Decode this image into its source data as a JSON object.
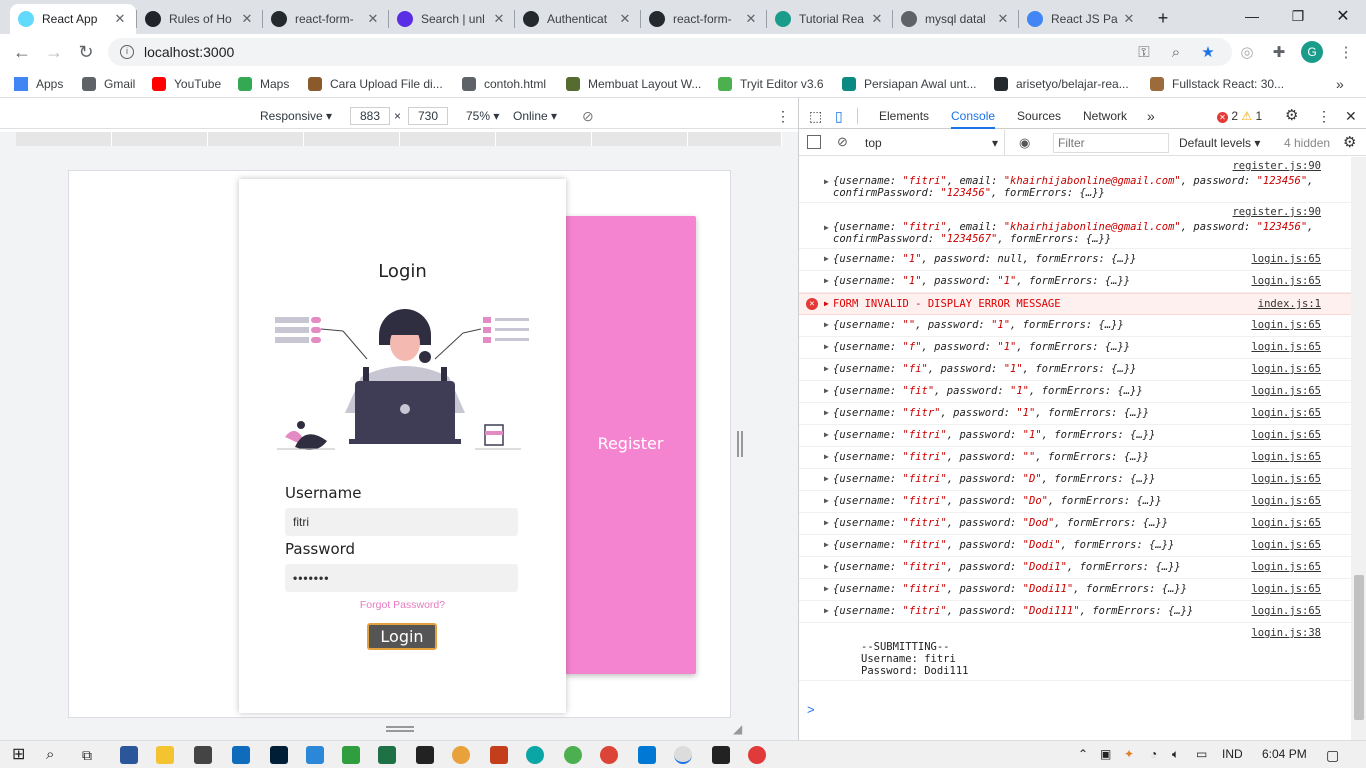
{
  "browser": {
    "tabs": [
      {
        "title": "React App",
        "active": true,
        "icon": "react-icon",
        "color": "#61dafb"
      },
      {
        "title": "Rules of Ho",
        "active": false,
        "icon": "react-icon",
        "color": "#20232a"
      },
      {
        "title": "react-form-",
        "active": false,
        "icon": "github-icon",
        "color": "#24292e"
      },
      {
        "title": "Search | unl",
        "active": false,
        "icon": "search-icon",
        "color": "#5b2ee6"
      },
      {
        "title": "Authenticat",
        "active": false,
        "icon": "github-icon",
        "color": "#24292e"
      },
      {
        "title": "react-form-",
        "active": false,
        "icon": "github-icon",
        "color": "#24292e"
      },
      {
        "title": "Tutorial Rea",
        "active": false,
        "icon": "tutorial-icon",
        "color": "#1a9c8a"
      },
      {
        "title": "mysql datal",
        "active": false,
        "icon": "globe-icon",
        "color": "#5f6368"
      },
      {
        "title": "React JS Pa",
        "active": false,
        "icon": "doc-icon",
        "color": "#4285f4"
      }
    ],
    "new_tab": "+",
    "url": "localhost:3000",
    "profile_initial": "G",
    "bookmarks": [
      {
        "label": "Apps",
        "icon": "apps-grid-icon",
        "color": "#4285f4"
      },
      {
        "label": "Gmail",
        "icon": "globe-icon",
        "color": "#5f6368"
      },
      {
        "label": "YouTube",
        "icon": "youtube-icon",
        "color": "#ff0000"
      },
      {
        "label": "Maps",
        "icon": "maps-icon",
        "color": "#34a853"
      },
      {
        "label": "Cara Upload File di...",
        "icon": "site-icon",
        "color": "#8a5a2b"
      },
      {
        "label": "contoh.html",
        "icon": "globe-icon",
        "color": "#5f6368"
      },
      {
        "label": "Membuat Layout W...",
        "icon": "w-icon",
        "color": "#556b2f"
      },
      {
        "label": "Tryit Editor v3.6",
        "icon": "w3-icon",
        "color": "#4caf50"
      },
      {
        "label": "Persiapan Awal unt...",
        "icon": "site-icon",
        "color": "#0b8a82"
      },
      {
        "label": "arisetyo/belajar-rea...",
        "icon": "github-icon",
        "color": "#24292e"
      },
      {
        "label": "Fullstack React: 30...",
        "icon": "site-icon",
        "color": "#9c6b3c"
      }
    ]
  },
  "device_toolbar": {
    "mode": "Responsive",
    "width": "883",
    "times": "×",
    "height": "730",
    "zoom": "75%",
    "network": "Online"
  },
  "app": {
    "login_title": "Login",
    "username_label": "Username",
    "username_value": "fitri",
    "password_label": "Password",
    "password_value": "•••••••",
    "forgot_link": "Forgot Password?",
    "login_button": "Login",
    "register_panel": "Register"
  },
  "devtools": {
    "tabs": [
      "Elements",
      "Console",
      "Sources",
      "Network"
    ],
    "active_tab": "Console",
    "more": "»",
    "error_count": "2",
    "warning_count": "1",
    "context": "top",
    "filter_placeholder": "Filter",
    "levels": "Default levels",
    "hidden": "4 hidden",
    "log": [
      {
        "src": "register.js:90",
        "text": "{username: \"fitri\", email: \"khairhijabonline@gmail.com\", password: \"123456\", confirmPassword: \"123456\", formErrors: {…}}",
        "type": "obj"
      },
      {
        "src": "register.js:90",
        "text": "{username: \"fitri\", email: \"khairhijabonline@gmail.com\", password: \"123456\", confirmPassword: \"1234567\", formErrors: {…}}",
        "type": "obj"
      },
      {
        "src": "login.js:65",
        "text": "{username: \"1\", password: null, formErrors: {…}}",
        "type": "obj"
      },
      {
        "src": "login.js:65",
        "text": "{username: \"1\", password: \"1\", formErrors: {…}}",
        "type": "obj"
      },
      {
        "src": "index.js:1",
        "text": "FORM INVALID - DISPLAY ERROR MESSAGE",
        "type": "error"
      },
      {
        "src": "login.js:65",
        "text": "{username: \"\", password: \"1\", formErrors: {…}}",
        "type": "obj"
      },
      {
        "src": "login.js:65",
        "text": "{username: \"f\", password: \"1\", formErrors: {…}}",
        "type": "obj"
      },
      {
        "src": "login.js:65",
        "text": "{username: \"fi\", password: \"1\", formErrors: {…}}",
        "type": "obj"
      },
      {
        "src": "login.js:65",
        "text": "{username: \"fit\", password: \"1\", formErrors: {…}}",
        "type": "obj"
      },
      {
        "src": "login.js:65",
        "text": "{username: \"fitr\", password: \"1\", formErrors: {…}}",
        "type": "obj"
      },
      {
        "src": "login.js:65",
        "text": "{username: \"fitri\", password: \"1\", formErrors: {…}}",
        "type": "obj"
      },
      {
        "src": "login.js:65",
        "text": "{username: \"fitri\", password: \"\", formErrors: {…}}",
        "type": "obj"
      },
      {
        "src": "login.js:65",
        "text": "{username: \"fitri\", password: \"D\", formErrors: {…}}",
        "type": "obj"
      },
      {
        "src": "login.js:65",
        "text": "{username: \"fitri\", password: \"Do\", formErrors: {…}}",
        "type": "obj"
      },
      {
        "src": "login.js:65",
        "text": "{username: \"fitri\", password: \"Dod\", formErrors: {…}}",
        "type": "obj"
      },
      {
        "src": "login.js:65",
        "text": "{username: \"fitri\", password: \"Dodi\", formErrors: {…}}",
        "type": "obj"
      },
      {
        "src": "login.js:65",
        "text": "{username: \"fitri\", password: \"Dodi1\", formErrors: {…}}",
        "type": "obj"
      },
      {
        "src": "login.js:65",
        "text": "{username: \"fitri\", password: \"Dodi11\", formErrors: {…}}",
        "type": "obj"
      },
      {
        "src": "login.js:65",
        "text": "{username: \"fitri\", password: \"Dodi111\", formErrors: {…}}",
        "type": "obj"
      },
      {
        "src": "login.js:38",
        "text": "--SUBMITTING--\nUsername: fitri\nPassword: Dodi111",
        "type": "plain"
      }
    ],
    "prompt": ">"
  },
  "taskbar": {
    "language": "IND",
    "time": "6:04 PM"
  },
  "colors": {
    "accent_pink": "#f484cf",
    "login_button_bg": "#555555",
    "login_button_border": "#e5a13b",
    "link_pink": "#e67ac0",
    "devtools_blue": "#1a73e8"
  }
}
